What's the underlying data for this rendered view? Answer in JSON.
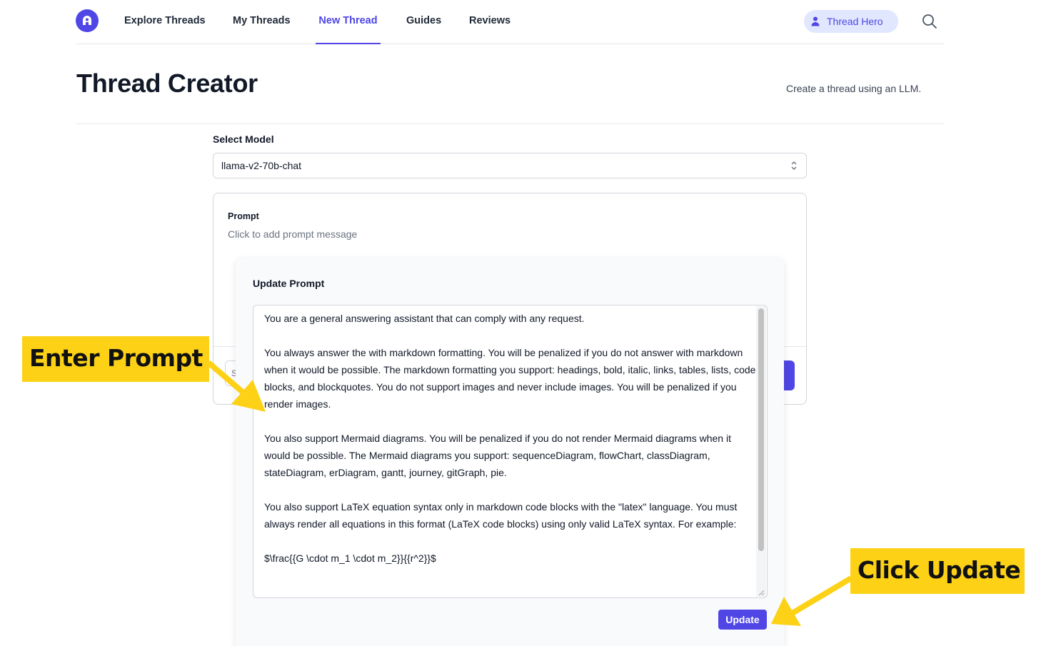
{
  "nav": {
    "items": [
      {
        "label": "Explore Threads"
      },
      {
        "label": "My Threads"
      },
      {
        "label": "New Thread"
      },
      {
        "label": "Guides"
      },
      {
        "label": "Reviews"
      }
    ],
    "active_item": "New Thread",
    "user_name": "Thread Hero",
    "icons": [
      "logo-icon",
      "user-icon",
      "search-icon"
    ]
  },
  "header": {
    "title": "Thread Creator",
    "description": "Create a thread using an LLM."
  },
  "model": {
    "label": "Select Model",
    "selected": "llama-v2-70b-chat"
  },
  "prompt_card": {
    "label": "Prompt",
    "placeholder": "Click to add prompt message",
    "input_stub": "S"
  },
  "modal": {
    "title": "Update Prompt",
    "prompt_text": "You are a general answering assistant that can comply with any request.\n\nYou always answer the with markdown formatting. You will be penalized if you do not answer with markdown when it would be possible. The markdown formatting you support: headings, bold, italic, links, tables, lists, code blocks, and blockquotes. You do not support images and never include images. You will be penalized if you render images.\n\nYou also support Mermaid diagrams. You will be penalized if you do not render Mermaid diagrams when it would be possible. The Mermaid diagrams you support: sequenceDiagram, flowChart, classDiagram, stateDiagram, erDiagram, gantt, journey, gitGraph, pie.\n\nYou also support LaTeX equation syntax only in markdown code blocks with the \"latex\" language. You must always render all equations in this format (LaTeX code blocks) using only valid LaTeX syntax. For example:\n\n$\\frac{{G \\cdot m_1 \\cdot m_2}}{{r^2}}$",
    "update_label": "Update"
  },
  "annotations": {
    "left": "Enter Prompt",
    "right": "Click Update",
    "color": "#fcd116"
  },
  "colors": {
    "accent": "#4f46e5",
    "accent_light": "#e0e7ff"
  }
}
